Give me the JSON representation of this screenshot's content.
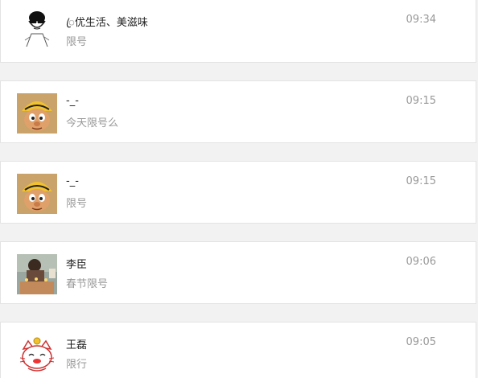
{
  "conversations": [
    {
      "name": "ꦿ优生活、美滋味",
      "message": "限号",
      "time": "09:34",
      "avatar": "sketch-man-sunglasses-icon"
    },
    {
      "name": "-_-",
      "message": "今天限号么",
      "time": "09:15",
      "avatar": "cartoon-boy-cap-icon"
    },
    {
      "name": "-_-",
      "message": "限号",
      "time": "09:15",
      "avatar": "cartoon-boy-cap-icon"
    },
    {
      "name": "李臣",
      "message": "春节限号",
      "time": "09:06",
      "avatar": "photo-child-birthday-icon"
    },
    {
      "name": "王磊",
      "message": "限行",
      "time": "09:05",
      "avatar": "lucky-cat-icon"
    }
  ],
  "colors": {
    "name": "#222222",
    "message": "#999999",
    "time": "#999999",
    "row_background": "#ffffff",
    "page_background": "#f2f2f2",
    "divider": "#e3e3e3"
  }
}
